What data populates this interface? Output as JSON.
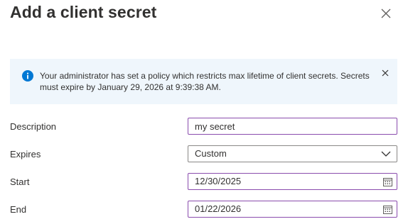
{
  "header": {
    "title": "Add a client secret"
  },
  "info": {
    "message": "Your administrator has set a policy which restricts max lifetime of client secrets. Secrets must expire by January 29, 2026 at 9:39:38 AM.",
    "icon": "info-icon"
  },
  "form": {
    "description": {
      "label": "Description",
      "value": "my secret"
    },
    "expires": {
      "label": "Expires",
      "value": "Custom"
    },
    "start": {
      "label": "Start",
      "value": "12/30/2025"
    },
    "end": {
      "label": "End",
      "value": "01/22/2026"
    }
  },
  "colors": {
    "accent": "#0078d4",
    "focus_border": "#8a4cad",
    "info_background": "#eff6fc"
  }
}
